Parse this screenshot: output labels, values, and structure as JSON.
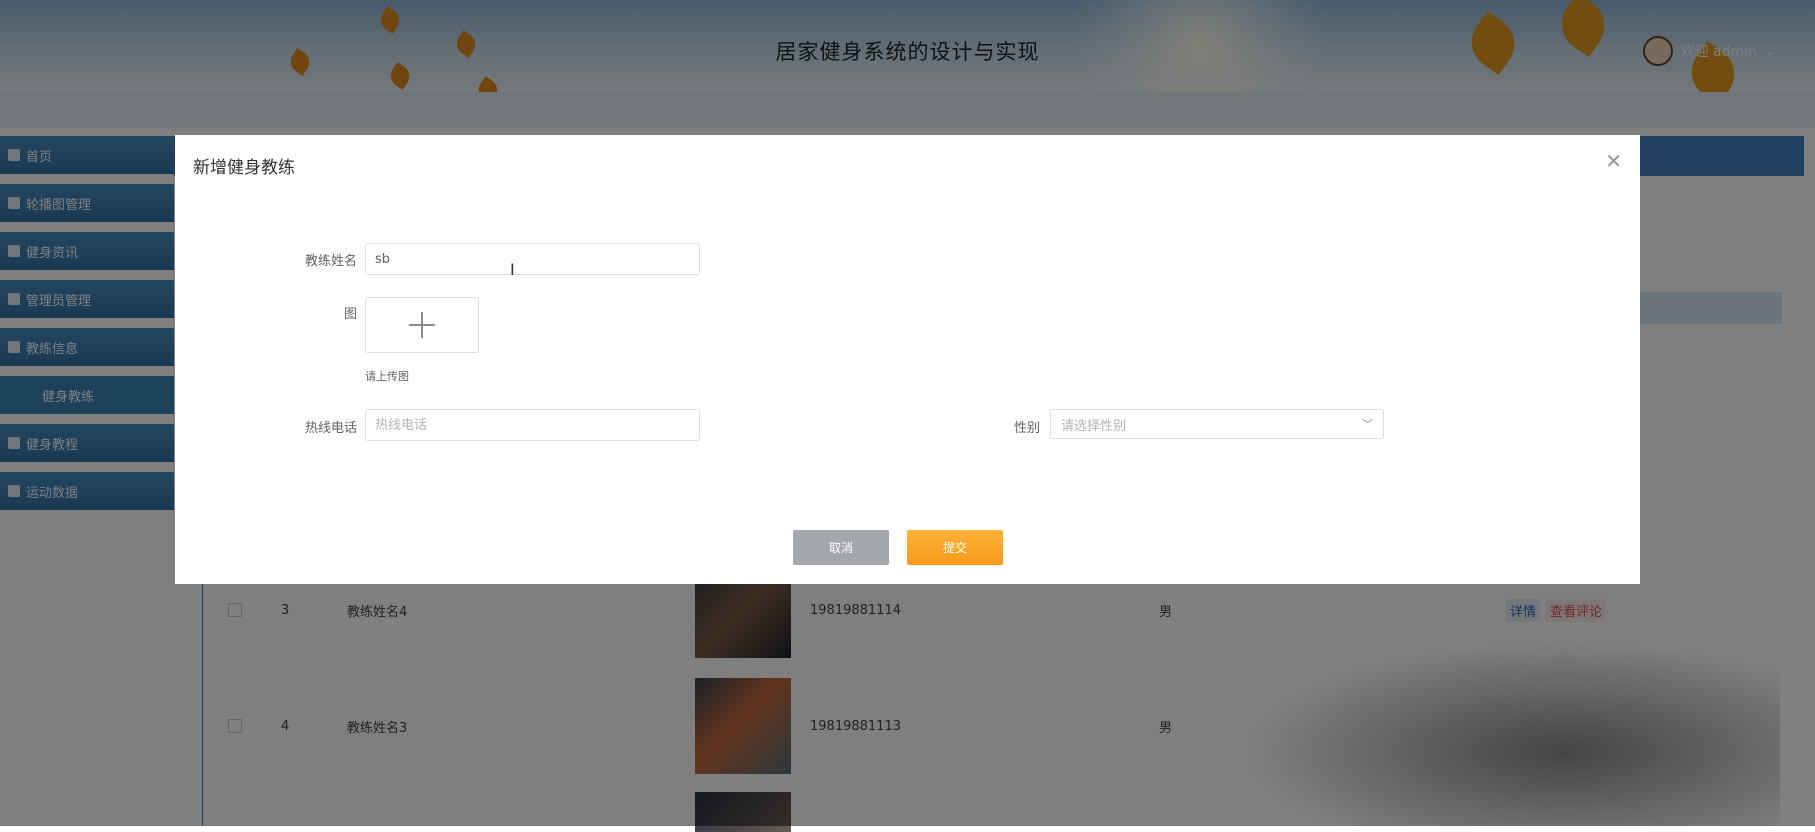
{
  "header": {
    "title": "居家健身系统的设计与实现",
    "welcome": "欢迎 admin"
  },
  "sidebar": {
    "items": [
      {
        "label": "首页"
      },
      {
        "label": "轮播图管理"
      },
      {
        "label": "健身资讯"
      },
      {
        "label": "管理员管理"
      },
      {
        "label": "教练信息"
      },
      {
        "label": "健身教练",
        "sub": true
      },
      {
        "label": "健身教程"
      },
      {
        "label": "运动数据"
      }
    ]
  },
  "table": {
    "rows": [
      {
        "index": "3",
        "name": "教练姓名4",
        "phone": "19819881114",
        "gender": "男",
        "detail": "详情",
        "comments": "查看评论"
      },
      {
        "index": "4",
        "name": "教练姓名3",
        "phone": "19819881113",
        "gender": "男"
      }
    ]
  },
  "modal": {
    "title": "新增健身教练",
    "close_icon": "close-icon",
    "fields": {
      "name_label": "教练姓名",
      "name_value": "sb",
      "image_label": "图",
      "upload_tip": "请上传图",
      "phone_label": "热线电话",
      "phone_placeholder": "热线电话",
      "gender_label": "性别",
      "gender_placeholder": "请选择性别"
    },
    "buttons": {
      "cancel": "取消",
      "submit": "提交"
    }
  },
  "colors": {
    "accent_orange": "#f99a1a",
    "sidebar_blue": "#2f73a8",
    "cancel_gray": "#a3a6ab"
  }
}
